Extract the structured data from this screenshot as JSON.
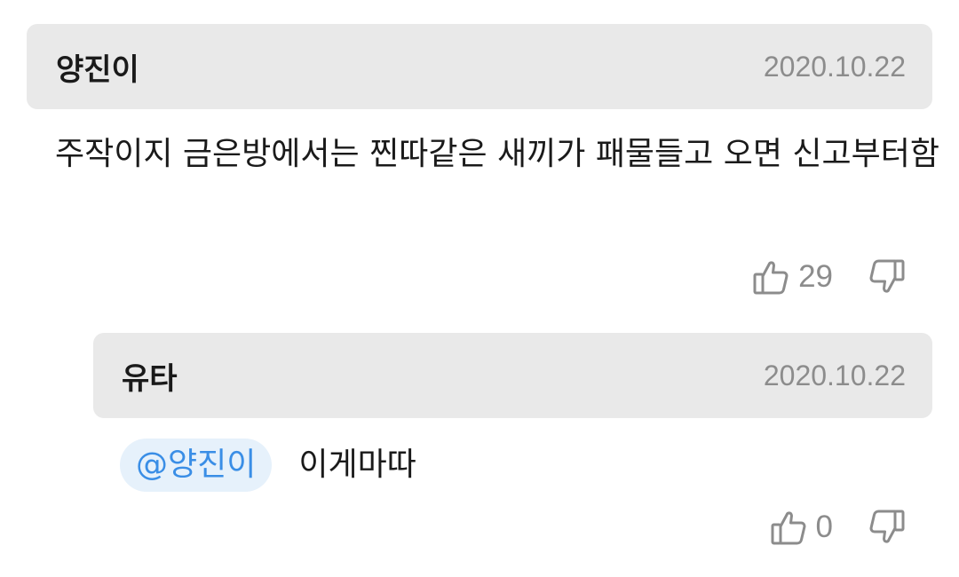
{
  "comments": [
    {
      "author": "양진이",
      "date": "2020.10.22",
      "text": "주작이지 금은방에서는 찐따같은 새끼가 패물들고 오면 신고부터함",
      "likes": "29",
      "like_icon": "thumbs-up-icon",
      "dislike_icon": "thumbs-down-icon"
    },
    {
      "author": "유타",
      "date": "2020.10.22",
      "mention": "@양진이",
      "text": "이게마따",
      "likes": "0",
      "like_icon": "thumbs-up-icon",
      "dislike_icon": "thumbs-down-icon"
    }
  ],
  "colors": {
    "header_bg": "#e9e9e9",
    "mention_bg": "#e6f1fb",
    "mention_text": "#3a8ee6",
    "muted_text": "#8c8c8c"
  }
}
